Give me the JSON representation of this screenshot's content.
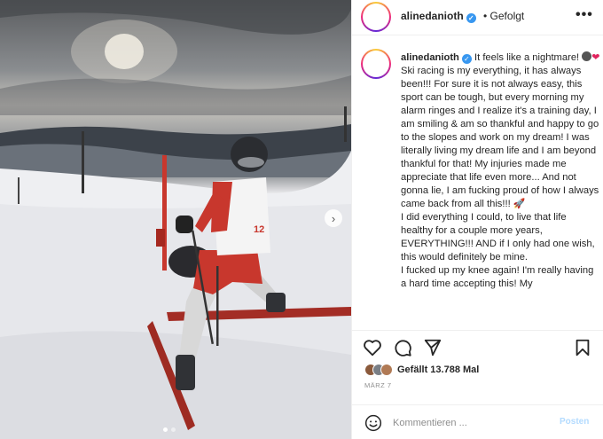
{
  "header": {
    "username": "alinedanioth",
    "verified_icon": "verified-badge",
    "follow_status": "Gefolgt",
    "more_icon": "more-horizontal-icon"
  },
  "caption": {
    "username": "alinedanioth",
    "first_line": "It feels like a nightmare!",
    "body": "Ski racing is my everything, it has always been!!! For sure it is not always easy, this sport can be tough, but every morning my alarm ringes and I realize it's a training day, I am smiling & am so thankful and happy to go to the slopes and work on my dream! I was literally living my dream life and I am beyond thankful for that! My injuries made me appreciate that life even more... And not gonna lie, I am fucking proud of how I always came back from all this!!!",
    "body2": "I did everything I could, to live that life healthy for a couple more years, EVERYTHING!!! AND if I only had one wish, this would definitely be mine.\nI fucked up my knee again! I'm really having a hard time accepting this! My"
  },
  "likes": {
    "text": "Gefällt 13.788 Mal"
  },
  "date": "MÄRZ 7",
  "comment": {
    "placeholder": "Kommentieren ...",
    "post_label": "Posten"
  },
  "colors": {
    "accent": "#3897f0",
    "jersey_red": "#c8372d",
    "heart": "#e0245e"
  },
  "carousel": {
    "current": 1,
    "total": 2
  }
}
